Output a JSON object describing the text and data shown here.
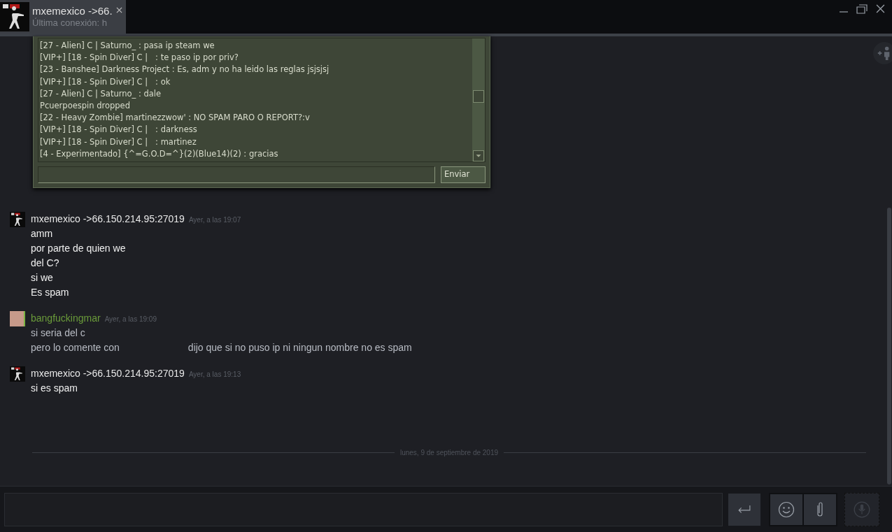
{
  "tab": {
    "name": "mxemexico ->66.",
    "status": "Última conexión: h"
  },
  "game_chat": {
    "lines": [
      "[27 - Alien] C | Saturno_ : pasa ip steam we",
      "[VIP+] [18 - Spin Diver] C |   : te paso ip por priv?",
      "[23 - Banshee] Darkness Project : Es, adm y no ha leido las reglas jsjsjsj",
      "[VIP+] [18 - Spin Diver] C |   : ok",
      "[27 - Alien] C | Saturno_ : dale",
      "Pcuerpoespin dropped",
      "[22 - Heavy Zombie] martinezzwow' : NO SPAM PARO O REPORT?:v",
      "[VIP+] [18 - Spin Diver] C |   : darkness",
      "[VIP+] [18 - Spin Diver] C |   : martinez",
      "[4 - Experimentado] {^=G.O.D=^}(2)(Blue14)(2) : gracias"
    ],
    "send_button": "Enviar"
  },
  "messages": [
    {
      "kind": "friend",
      "name": "mxemexico ->66.150.214.95:27019",
      "time": "Ayer, a las 19:07",
      "lines": [
        [
          "amm"
        ],
        [
          "por parte de quien we"
        ],
        [
          "del C?"
        ],
        [
          "si we"
        ],
        [
          "Es spam"
        ]
      ]
    },
    {
      "kind": "self",
      "name": "bangfuckingmar",
      "time": "Ayer, a las 19:09",
      "lines": [
        [
          "si seria del c"
        ],
        [
          "pero lo comente con",
          "dijo que si no puso ip ni ningun nombre no es spam"
        ]
      ]
    },
    {
      "kind": "friend",
      "name": "mxemexico ->66.150.214.95:27019",
      "time": "Ayer, a las 19:13",
      "lines": [
        [
          "si es spam"
        ]
      ]
    }
  ],
  "date_divider": "lunes, 9 de septiembre de 2019"
}
